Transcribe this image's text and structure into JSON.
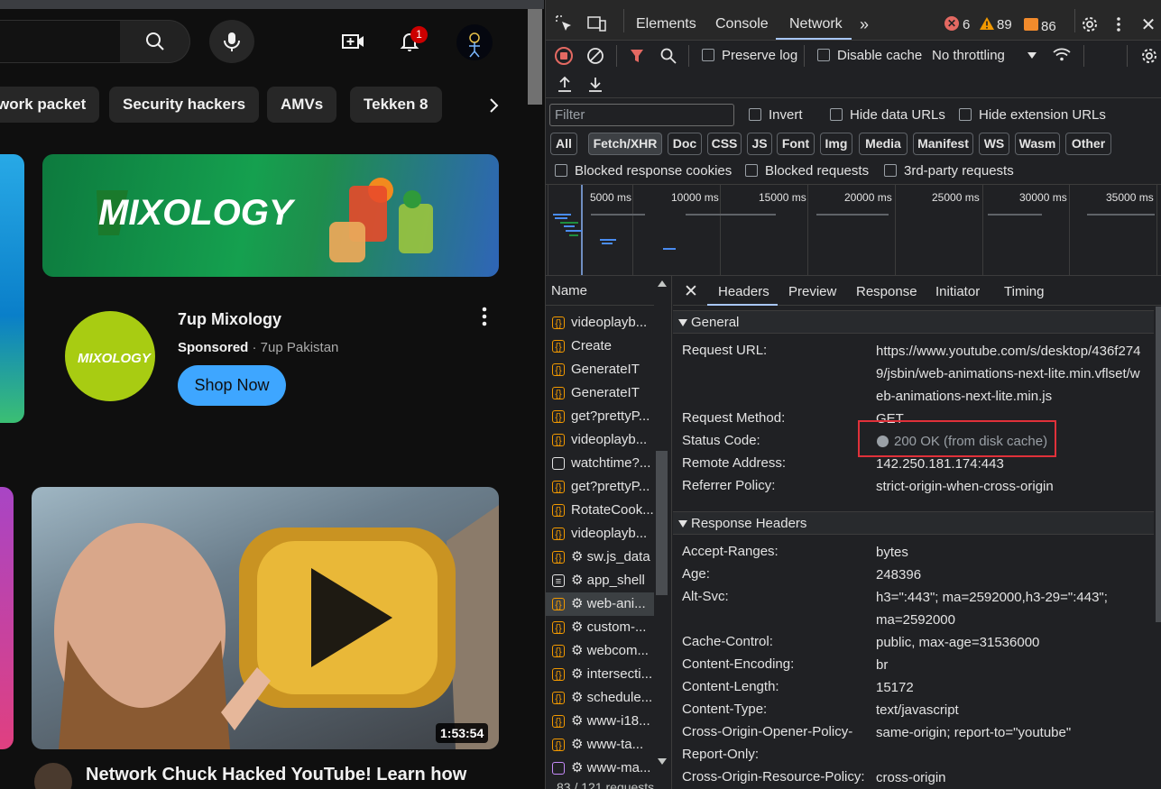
{
  "youtube": {
    "notification_count": "1",
    "chips": [
      "work packet",
      "Security hackers",
      "AMVs",
      "Tekken 8"
    ],
    "ad": {
      "banner_text": "MIXOLOGY",
      "logo_text": "MIXOLOGY",
      "title": "7up Mixology",
      "sponsored": "Sponsored",
      "advertiser": " · 7up Pakistan",
      "cta": "Shop Now"
    },
    "video": {
      "duration": "1:53:54",
      "title": "Network Chuck Hacked YouTube! Learn how"
    }
  },
  "devtools": {
    "tabs": [
      "Elements",
      "Console",
      "Network"
    ],
    "active_tab": "Network",
    "errors": "6",
    "warnings": "89",
    "issues": "86",
    "toolbar": {
      "preserve_log": "Preserve log",
      "disable_cache": "Disable cache",
      "throttling": "No throttling"
    },
    "filter": {
      "placeholder": "Filter",
      "invert": "Invert",
      "hide_data_urls": "Hide data URLs",
      "hide_extension_urls": "Hide extension URLs",
      "types": [
        "All",
        "Fetch/XHR",
        "Doc",
        "CSS",
        "JS",
        "Font",
        "Img",
        "Media",
        "Manifest",
        "WS",
        "Wasm",
        "Other"
      ],
      "blocked_cookies": "Blocked response cookies",
      "blocked_requests": "Blocked requests",
      "third_party": "3rd-party requests"
    },
    "timeline": [
      "5000 ms",
      "10000 ms",
      "15000 ms",
      "20000 ms",
      "25000 ms",
      "30000 ms",
      "35000 ms"
    ],
    "name_header": "Name",
    "requests": [
      "videoplayb...",
      "Create",
      "GenerateIT",
      "GenerateIT",
      "get?prettyP...",
      "videoplayb...",
      "watchtime?...",
      "get?prettyP...",
      "RotateCook...",
      "videoplayb...",
      "⚙ sw.js_data",
      "⚙ app_shell",
      "⚙ web-ani...",
      "⚙ custom-...",
      "⚙ webcom...",
      "⚙ intersecti...",
      "⚙ schedule...",
      "⚙ www-i18...",
      "⚙ www-ta...",
      "⚙ www-ma..."
    ],
    "footer": "83 / 121 requests",
    "detail_tabs": [
      "Headers",
      "Preview",
      "Response",
      "Initiator",
      "Timing"
    ],
    "general": {
      "title": "General",
      "request_url_label": "Request URL:",
      "request_url_1": "https://www.youtube.com/s/desktop/436f274",
      "request_url_2": "9/jsbin/web-animations-next-lite.min.vflset/w",
      "request_url_3": "eb-animations-next-lite.min.js",
      "method_label": "Request Method:",
      "method": "GET",
      "status_label": "Status Code:",
      "status": "200 OK (from disk cache)",
      "remote_label": "Remote Address:",
      "remote": "142.250.181.174:443",
      "referrer_label": "Referrer Policy:",
      "referrer": "strict-origin-when-cross-origin"
    },
    "response_headers": {
      "title": "Response Headers",
      "accept_ranges_label": "Accept-Ranges:",
      "accept_ranges": "bytes",
      "age_label": "Age:",
      "age": "248396",
      "alt_svc_label": "Alt-Svc:",
      "alt_svc_1": "h3=\":443\"; ma=2592000,h3-29=\":443\";",
      "alt_svc_2": "ma=2592000",
      "cache_label": "Cache-Control:",
      "cache": "public, max-age=31536000",
      "enc_label": "Content-Encoding:",
      "enc": "br",
      "len_label": "Content-Length:",
      "len": "15172",
      "type_label": "Content-Type:",
      "type": "text/javascript",
      "coop_label_1": "Cross-Origin-Opener-Policy-",
      "coop_label_2": "Report-Only:",
      "coop": "same-origin; report-to=\"youtube\"",
      "corp_label": "Cross-Origin-Resource-Policy:",
      "corp": "cross-origin"
    }
  }
}
